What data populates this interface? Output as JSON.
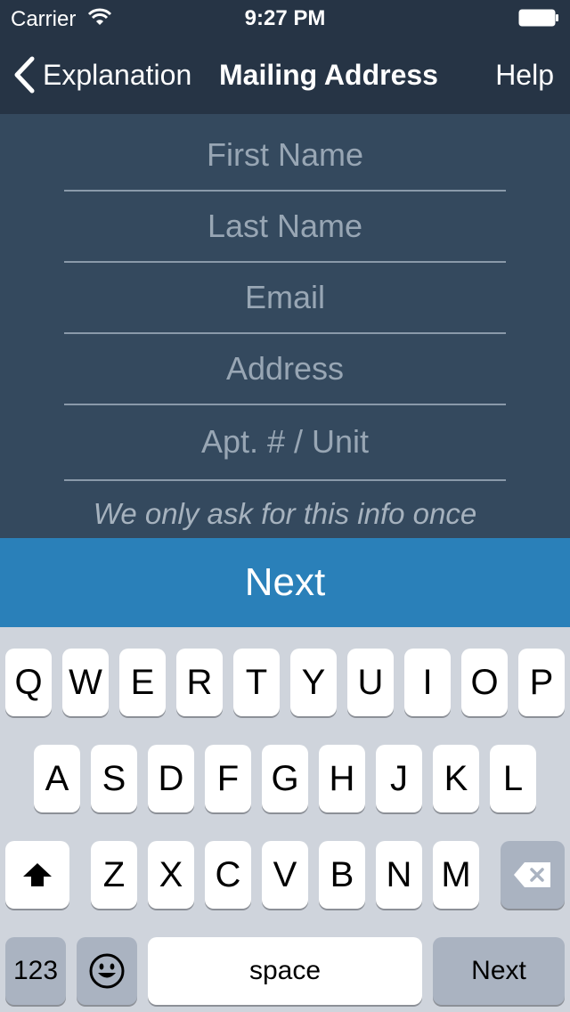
{
  "status_bar": {
    "carrier": "Carrier",
    "time": "9:27 PM"
  },
  "nav": {
    "back_label": "Explanation",
    "title": "Mailing Address",
    "help_label": "Help"
  },
  "form": {
    "fields": [
      {
        "placeholder": "First Name"
      },
      {
        "placeholder": "Last Name"
      },
      {
        "placeholder": "Email"
      },
      {
        "placeholder": "Address"
      },
      {
        "placeholder": "Apt. # / Unit"
      }
    ],
    "note": "We only ask for this info once"
  },
  "next_button": "Next",
  "keyboard": {
    "row1": [
      "Q",
      "W",
      "E",
      "R",
      "T",
      "Y",
      "U",
      "I",
      "O",
      "P"
    ],
    "row2": [
      "A",
      "S",
      "D",
      "F",
      "G",
      "H",
      "J",
      "K",
      "L"
    ],
    "row3": [
      "Z",
      "X",
      "C",
      "V",
      "B",
      "N",
      "M"
    ],
    "numbers_label": "123",
    "space_label": "space",
    "return_label": "Next"
  }
}
